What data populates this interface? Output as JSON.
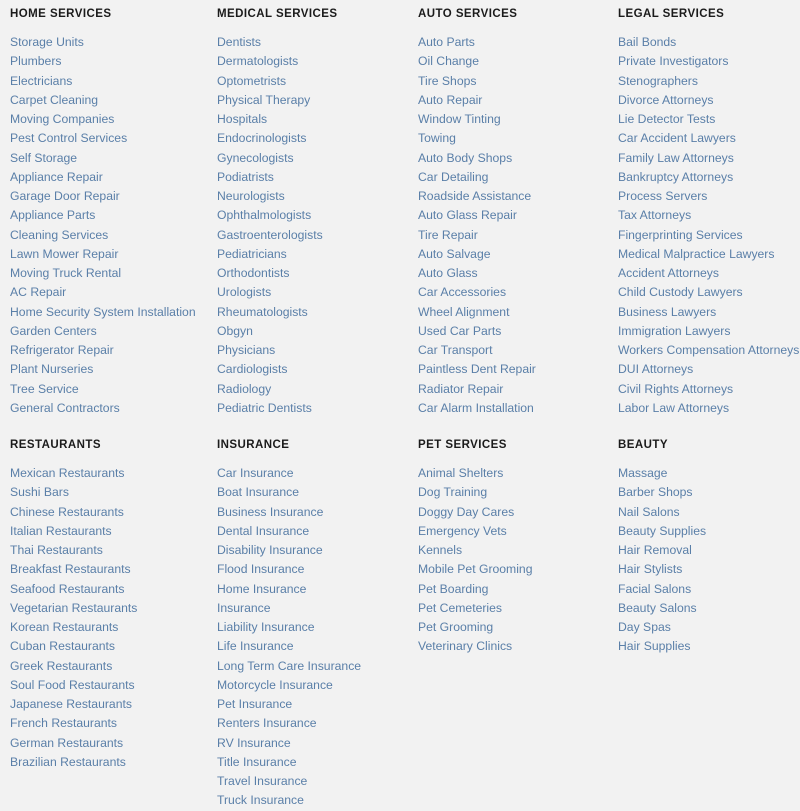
{
  "page": {
    "background_color": "#f2f2f2",
    "link_color": "#5a7fa8",
    "heading_color": "#1b1b1b"
  },
  "columns": [
    {
      "name": "column-1",
      "sections": [
        {
          "title": "HOME SERVICES",
          "links": [
            "Storage Units",
            "Plumbers",
            "Electricians",
            "Carpet Cleaning",
            "Moving Companies",
            "Pest Control Services",
            "Self Storage",
            "Appliance Repair",
            "Garage Door Repair",
            "Appliance Parts",
            "Cleaning Services",
            "Lawn Mower Repair",
            "Moving Truck Rental",
            "AC Repair",
            "Home Security System Installation",
            "Garden Centers",
            "Refrigerator Repair",
            "Plant Nurseries",
            "Tree Service",
            "General Contractors"
          ]
        },
        {
          "title": "RESTAURANTS",
          "links": [
            "Mexican Restaurants",
            "Sushi Bars",
            "Chinese Restaurants",
            "Italian Restaurants",
            "Thai Restaurants",
            "Breakfast Restaurants",
            "Seafood Restaurants",
            "Vegetarian Restaurants",
            "Korean Restaurants",
            "Cuban Restaurants",
            "Greek Restaurants",
            "Soul Food Restaurants",
            "Japanese Restaurants",
            "French Restaurants",
            "German Restaurants",
            "Brazilian Restaurants"
          ]
        }
      ]
    },
    {
      "name": "column-2",
      "sections": [
        {
          "title": "MEDICAL SERVICES",
          "links": [
            "Dentists",
            "Dermatologists",
            "Optometrists",
            "Physical Therapy",
            "Hospitals",
            "Endocrinologists",
            "Gynecologists",
            "Podiatrists",
            "Neurologists",
            "Ophthalmologists",
            "Gastroenterologists",
            "Pediatricians",
            "Orthodontists",
            "Urologists",
            "Rheumatologists",
            "Obgyn",
            "Physicians",
            "Cardiologists",
            "Radiology",
            "Pediatric Dentists"
          ]
        },
        {
          "title": "INSURANCE",
          "links": [
            "Car Insurance",
            "Boat Insurance",
            "Business Insurance",
            "Dental Insurance",
            "Disability Insurance",
            "Flood Insurance",
            "Home Insurance",
            "Insurance",
            "Liability Insurance",
            "Life Insurance",
            "Long Term Care Insurance",
            "Motorcycle Insurance",
            "Pet Insurance",
            "Renters Insurance",
            "RV Insurance",
            "Title Insurance",
            "Travel Insurance",
            "Truck Insurance"
          ]
        }
      ]
    },
    {
      "name": "column-3",
      "sections": [
        {
          "title": "AUTO SERVICES",
          "links": [
            "Auto Parts",
            "Oil Change",
            "Tire Shops",
            "Auto Repair",
            "Window Tinting",
            "Towing",
            "Auto Body Shops",
            "Car Detailing",
            "Roadside Assistance",
            "Auto Glass Repair",
            "Tire Repair",
            "Auto Salvage",
            "Auto Glass",
            "Car Accessories",
            "Wheel Alignment",
            "Used Car Parts",
            "Car Transport",
            "Paintless Dent Repair",
            "Radiator Repair",
            "Car Alarm Installation"
          ]
        },
        {
          "title": "PET SERVICES",
          "links": [
            "Animal Shelters",
            "Dog Training",
            "Doggy Day Cares",
            "Emergency Vets",
            "Kennels",
            "Mobile Pet Grooming",
            "Pet Boarding",
            "Pet Cemeteries",
            "Pet Grooming",
            "Veterinary Clinics"
          ]
        }
      ]
    },
    {
      "name": "column-4",
      "sections": [
        {
          "title": "LEGAL SERVICES",
          "links": [
            "Bail Bonds",
            "Private Investigators",
            "Stenographers",
            "Divorce Attorneys",
            "Lie Detector Tests",
            "Car Accident Lawyers",
            "Family Law Attorneys",
            "Bankruptcy Attorneys",
            "Process Servers",
            "Tax Attorneys",
            "Fingerprinting Services",
            "Medical Malpractice Lawyers",
            "Accident Attorneys",
            "Child Custody Lawyers",
            "Business Lawyers",
            "Immigration Lawyers",
            "Workers Compensation Attorneys",
            "DUI Attorneys",
            "Civil Rights Attorneys",
            "Labor Law Attorneys"
          ]
        },
        {
          "title": "BEAUTY",
          "links": [
            "Massage",
            "Barber Shops",
            "Nail Salons",
            "Beauty Supplies",
            "Hair Removal",
            "Hair Stylists",
            "Facial Salons",
            "Beauty Salons",
            "Day Spas",
            "Hair Supplies"
          ]
        }
      ]
    }
  ]
}
